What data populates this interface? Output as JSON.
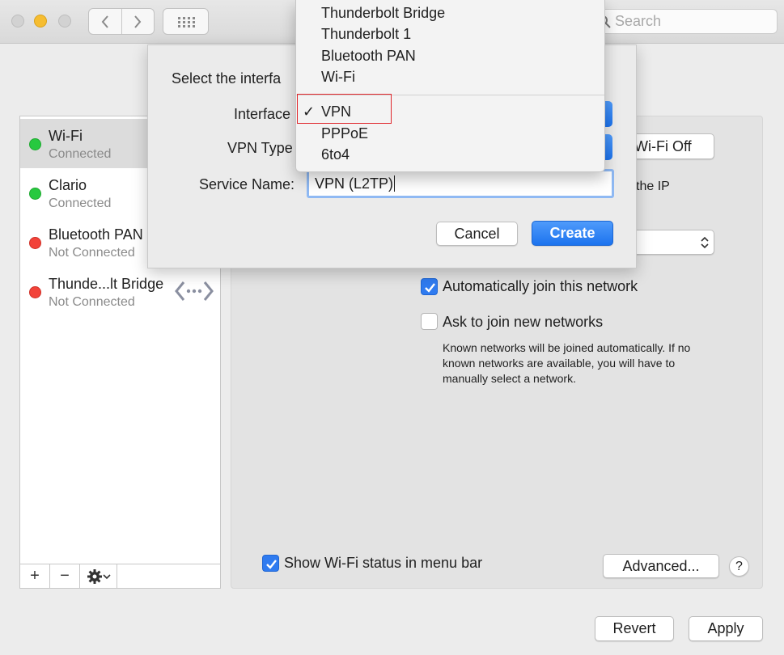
{
  "toolbar": {
    "search_placeholder": "Search"
  },
  "sidebar": {
    "services": [
      {
        "name": "Wi-Fi",
        "status": "Connected",
        "status_color": "#27c93f"
      },
      {
        "name": "Clario",
        "status": "Connected",
        "status_color": "#27c93f"
      },
      {
        "name": "Bluetooth PAN",
        "status": "Not Connected",
        "status_color": "#f2433a"
      },
      {
        "name": "Thunde...lt Bridge",
        "status": "Not Connected",
        "status_color": "#f2433a"
      }
    ],
    "add_label": "+",
    "remove_label": "−"
  },
  "panel": {
    "wifi_off_label": "Wi-Fi Off",
    "ip_text_fragment": "the IP",
    "auto_join_label": "Automatically join this network",
    "auto_join_checked": true,
    "ask_join_label": "Ask to join new networks",
    "ask_join_checked": false,
    "ask_join_help": "Known networks will be joined automatically. If no known networks are available, you will have to manually select a network.",
    "show_status_label": "Show Wi-Fi status in menu bar",
    "show_status_checked": true,
    "advanced_label": "Advanced...",
    "help_label": "?"
  },
  "footer": {
    "revert_label": "Revert",
    "apply_label": "Apply"
  },
  "sheet": {
    "prompt": "Select the interfa",
    "interface_label": "Interface",
    "vpn_type_label": "VPN Type",
    "service_name_label": "Service Name:",
    "service_name_value": "VPN (L2TP)",
    "cancel_label": "Cancel",
    "create_label": "Create"
  },
  "interface_menu": {
    "items_top": [
      "Thunderbolt Bridge",
      "Thunderbolt 1",
      "Bluetooth PAN",
      "Wi-Fi"
    ],
    "items_bottom": [
      "VPN",
      "PPPoE",
      "6to4"
    ],
    "selected": "VPN",
    "checkmark": "✓"
  },
  "colors": {
    "accent": "#2f7bf0",
    "highlight_box": "#e0262b"
  }
}
